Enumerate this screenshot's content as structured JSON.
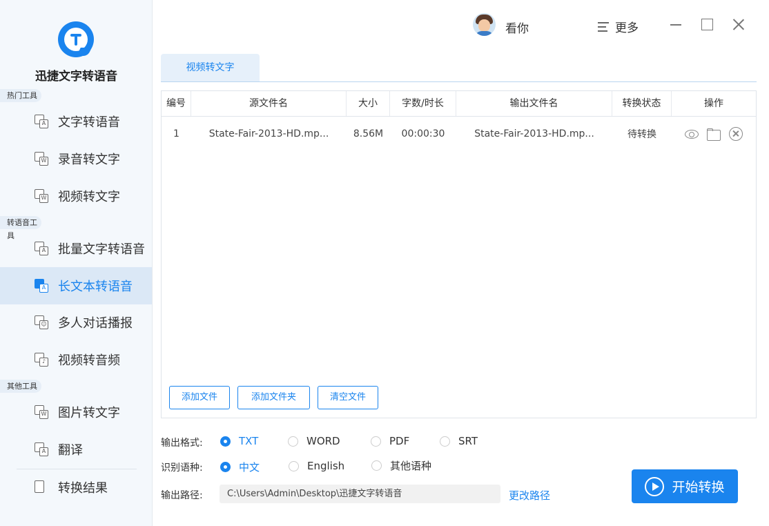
{
  "app": {
    "name": "迅捷文字转语音"
  },
  "colors": {
    "accent": "#1a84ee",
    "sidebar_bg": "#f4f8fc",
    "active_bg": "#dbe8f6"
  },
  "sidebar": {
    "sections": [
      {
        "label": "热门工具"
      },
      {
        "label": "转语音工具"
      },
      {
        "label": "其他工具"
      }
    ],
    "items": [
      {
        "label": "文字转语音",
        "icon": "text-to-speech-icon"
      },
      {
        "label": "录音转文字",
        "icon": "recording-to-text-icon"
      },
      {
        "label": "视频转文字",
        "icon": "video-to-text-icon"
      },
      {
        "label": "批量文字转语音",
        "icon": "batch-text-to-speech-icon"
      },
      {
        "label": "长文本转语音",
        "icon": "long-text-to-speech-icon",
        "active": true
      },
      {
        "label": "多人对话播报",
        "icon": "multi-dialogue-icon"
      },
      {
        "label": "视频转音频",
        "icon": "video-to-audio-icon"
      },
      {
        "label": "图片转文字",
        "icon": "image-to-text-icon"
      },
      {
        "label": "翻译",
        "icon": "translate-icon"
      },
      {
        "label": "转换结果",
        "icon": "results-icon"
      }
    ]
  },
  "topbar": {
    "username": "看你",
    "more_label": "更多"
  },
  "tab": {
    "label": "视频转文字"
  },
  "table": {
    "headers": [
      "编号",
      "源文件名",
      "大小",
      "字数/时长",
      "输出文件名",
      "转换状态",
      "操作"
    ],
    "rows": [
      {
        "index": "1",
        "source": "State-Fair-2013-HD.mp...",
        "size": "8.56M",
        "duration": "00:00:30",
        "output": "State-Fair-2013-HD.mp...",
        "status": "待转换"
      }
    ]
  },
  "buttons": {
    "add_file": "添加文件",
    "add_folder": "添加文件夹",
    "clear_files": "清空文件",
    "start": "开始转换",
    "change_path": "更改路径"
  },
  "options": {
    "format_label": "输出格式:",
    "formats": [
      {
        "label": "TXT",
        "checked": true
      },
      {
        "label": "WORD",
        "checked": false
      },
      {
        "label": "PDF",
        "checked": false
      },
      {
        "label": "SRT",
        "checked": false
      }
    ],
    "language_label": "识别语种:",
    "languages": [
      {
        "label": "中文",
        "checked": true
      },
      {
        "label": "English",
        "checked": false
      },
      {
        "label": "其他语种",
        "checked": false
      }
    ],
    "path_label": "输出路径:",
    "path_value": "C:\\Users\\Admin\\Desktop\\迅捷文字转语音"
  }
}
